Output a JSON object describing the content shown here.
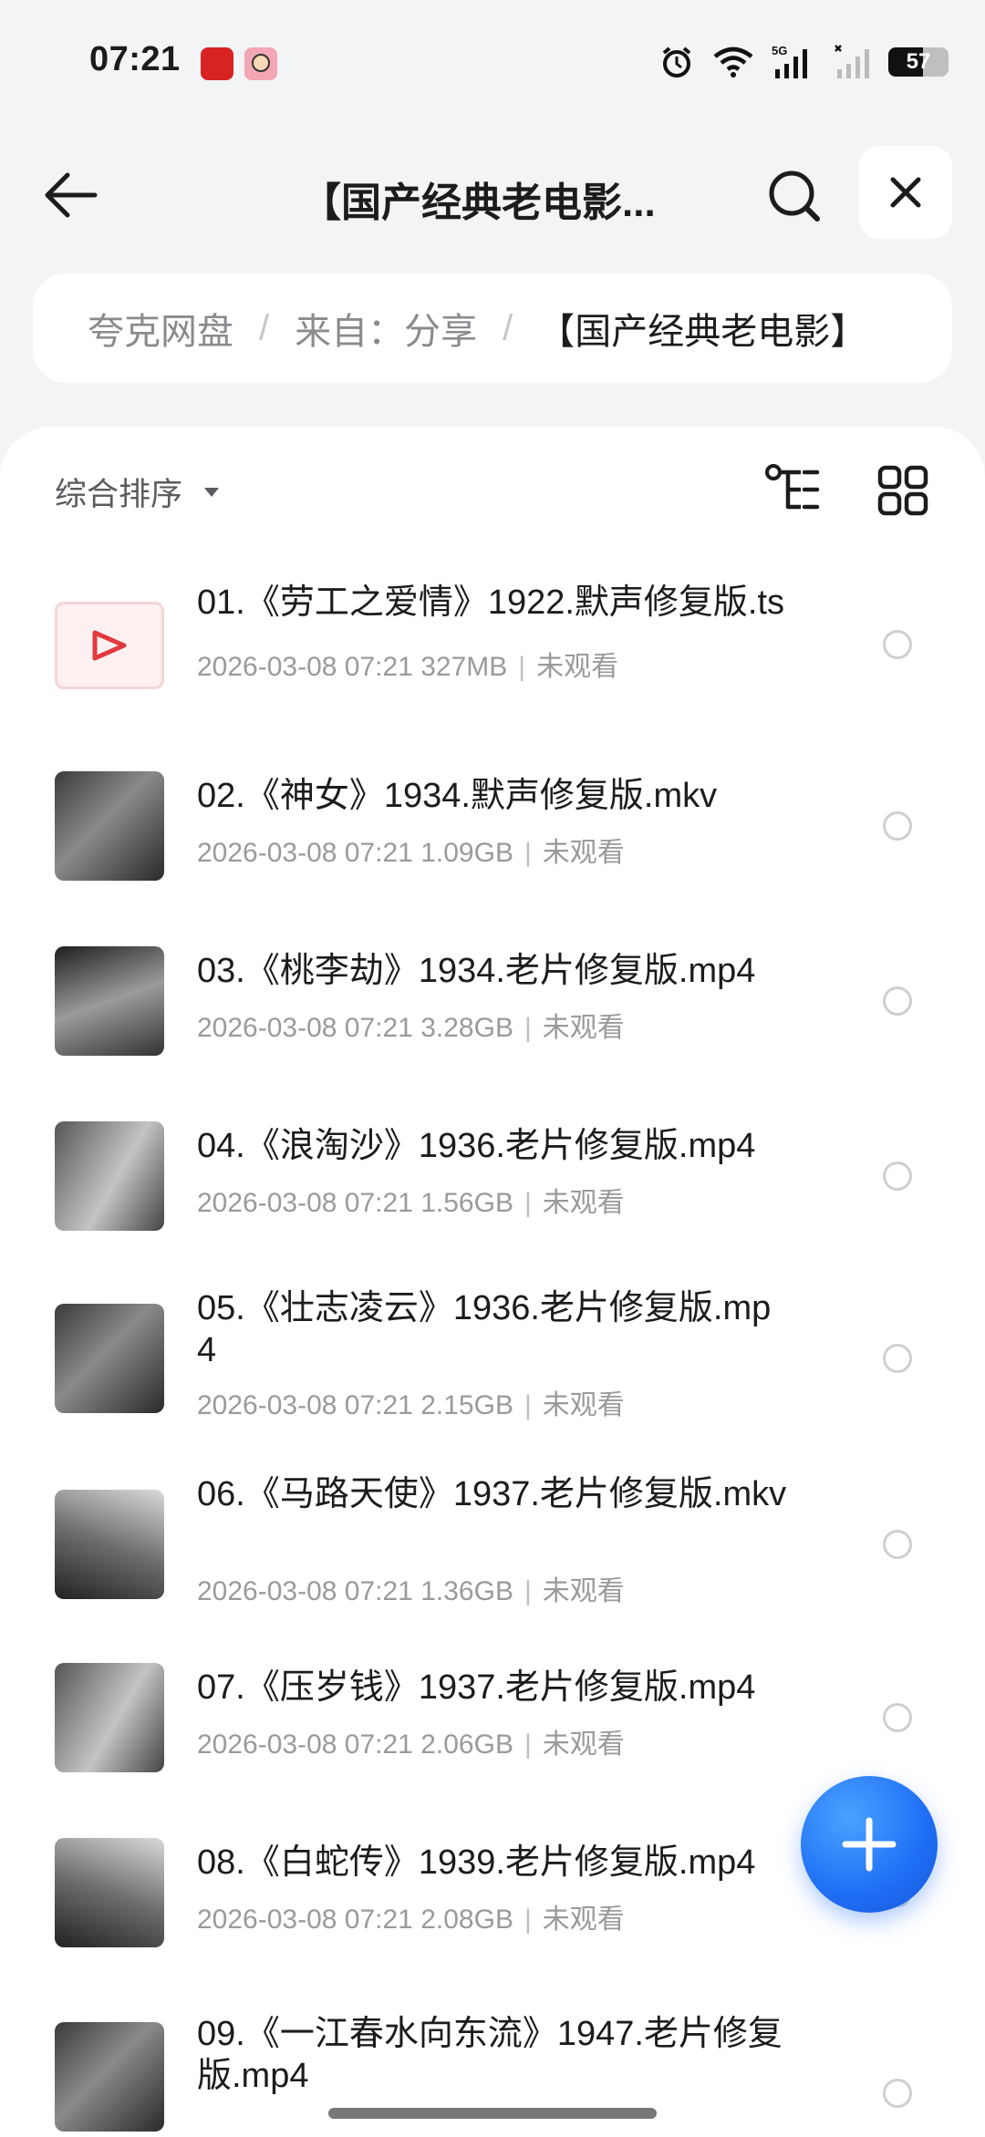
{
  "status_bar": {
    "time": "07:21",
    "network": "5G",
    "battery_level": "57",
    "battery_fraction": 0.57,
    "icons": [
      "alarm-icon",
      "wifi-icon",
      "signal-5g-icon",
      "signal-icon"
    ]
  },
  "header": {
    "title": "【国产经典老电影...",
    "back_icon": "arrow-left-icon",
    "search_icon": "search-icon",
    "close_icon": "close-icon"
  },
  "breadcrumb": {
    "items": [
      "夸克网盘",
      "来自：分享",
      "【国产经典老电影】"
    ],
    "separator": "/"
  },
  "toolbar": {
    "sort_label": "综合排序",
    "sort_icon": "caret-down-icon",
    "tree_icon": "tree-view-icon",
    "grid_icon": "grid-view-icon"
  },
  "files": [
    {
      "name": "01.《劳工之爱情》1922.默声修复版.ts",
      "date": "2026-03-08 07:21",
      "size": "327MB",
      "status": "未观看"
    },
    {
      "name": "02.《神女》1934.默声修复版.mkv",
      "date": "2026-03-08 07:21",
      "size": "1.09GB",
      "status": "未观看"
    },
    {
      "name": "03.《桃李劫》1934.老片修复版.mp4",
      "date": "2026-03-08 07:21",
      "size": "3.28GB",
      "status": "未观看"
    },
    {
      "name": "04.《浪淘沙》1936.老片修复版.mp4",
      "date": "2026-03-08 07:21",
      "size": "1.56GB",
      "status": "未观看"
    },
    {
      "name": "05.《壮志凌云》1936.老片修复版.mp4",
      "date": "2026-03-08 07:21",
      "size": "2.15GB",
      "status": "未观看"
    },
    {
      "name": "06.《马路天使》1937.老片修复版.mkv",
      "date": "2026-03-08 07:21",
      "size": "1.36GB",
      "status": "未观看"
    },
    {
      "name": "07.《压岁钱》1937.老片修复版.mp4",
      "date": "2026-03-08 07:21",
      "size": "2.06GB",
      "status": "未观看"
    },
    {
      "name": "08.《白蛇传》1939.老片修复版.mp4",
      "date": "2026-03-08 07:21",
      "size": "2.08GB",
      "status": "未观看"
    },
    {
      "name": "09.《一江春水向东流》1947.老片修复版.mp4",
      "date": "",
      "size": "",
      "status": ""
    }
  ],
  "fab": {
    "icon": "plus-icon"
  },
  "colors": {
    "accent": "#1f6ef5",
    "background": "#f3f4f6",
    "video_icon": "#e0393e"
  }
}
